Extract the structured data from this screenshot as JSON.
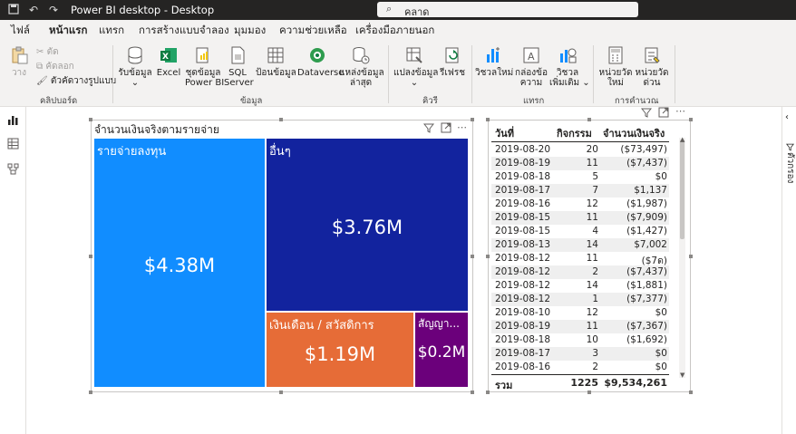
{
  "app": {
    "title": "Power BI desktop - Desktop",
    "search_value": "คลาด"
  },
  "menu": {
    "tabs": [
      "ไฟล์",
      "หน้าแรก",
      "แทรก",
      "การสร้างแบบจำลอง",
      "มุมมอง",
      "ความช่วยเหลือ",
      "เครื่องมือภายนอก"
    ],
    "active_index": 1
  },
  "ribbon": {
    "clipboard": {
      "paste": "วาง",
      "cut": "ตัด",
      "copy": "คัดลอก",
      "format_painter": "ตัวคัดวางรูปแบบ",
      "group": "คลิปบอร์ด"
    },
    "data": {
      "get_data": "รับข้อมูล",
      "excel": "Excel",
      "pbi_datasets_1": "ชุดข้อมูล",
      "pbi_datasets_2": "Power BI",
      "sql_1": "SQL",
      "sql_2": "Server",
      "enter_data": "ป้อนข้อมูล",
      "dataverse": "Dataverse",
      "recent_1": "แหล่งข้อมูล",
      "recent_2": "ล่าสุด",
      "group": "ข้อมูล"
    },
    "queries": {
      "transform": "แปลงข้อมูล",
      "refresh": "รีเฟรช",
      "group": "คิวรี"
    },
    "insert": {
      "new_visual": "วิชวลใหม่",
      "textbox_1": "กล่องข้อ",
      "textbox_2": "ความ",
      "more_visuals_1": "วิชวล",
      "more_visuals_2": "เพิ่มเติม",
      "group": "แทรก"
    },
    "calculations": {
      "new_measure_1": "หน่วยวัด",
      "new_measure_2": "ใหม่",
      "quick_measure_1": "หน่วยวัด",
      "quick_measure_2": "ด่วน",
      "group": "การคำนวณ"
    }
  },
  "right_panel": {
    "label": "ตัวกรอง"
  },
  "treemap": {
    "title": "จำนวนเงินจริงตามรายจ่าย",
    "tiles": [
      {
        "name": "รายจ่ายลงทุน",
        "label": "$4.38M",
        "value": 4.38,
        "color": "#118DFF"
      },
      {
        "name": "อื่นๆ",
        "label": "$3.76M",
        "value": 3.76,
        "color": "#12239E"
      },
      {
        "name": "เงินเดือน / สวัสดิการ",
        "label": "$1.19M",
        "value": 1.19,
        "color": "#E66C37"
      },
      {
        "name": "สัญญา...",
        "label": "$0.2M",
        "value": 0.2,
        "color": "#6B007B"
      }
    ]
  },
  "table": {
    "headers": [
      "วันที่",
      "กิจกรรม",
      "จำนวนเงินจริง"
    ],
    "rows": [
      [
        "2019-08-20",
        "20",
        "($73,497)"
      ],
      [
        "2019-08-19",
        "11",
        "($7,437)"
      ],
      [
        "2019-08-18",
        "5",
        "$0"
      ],
      [
        "2019-08-17",
        "7",
        "$1,137"
      ],
      [
        "2019-08-16",
        "12",
        "($1,987)"
      ],
      [
        "2019-08-15",
        "11",
        "($7,909)"
      ],
      [
        "2019-08-15",
        "4",
        "($1,427)"
      ],
      [
        "2019-08-13",
        "14",
        "$7,002"
      ],
      [
        "2019-08-12",
        "11",
        "($7ด)"
      ],
      [
        "2019-08-12",
        "2",
        "($7,437)"
      ],
      [
        "2019-08-12",
        "14",
        "($1,881)"
      ],
      [
        "2019-08-12",
        "1",
        "($7,377)"
      ],
      [
        "2019-08-10",
        "12",
        "$0"
      ],
      [
        "2019-08-19",
        "11",
        "($7,367)"
      ],
      [
        "2019-08-18",
        "10",
        "($1,692)"
      ],
      [
        "2019-08-17",
        "3",
        "$0"
      ],
      [
        "2019-08-16",
        "2",
        "$0"
      ]
    ],
    "total": [
      "รวม",
      "1225",
      "$9,534,261"
    ]
  }
}
